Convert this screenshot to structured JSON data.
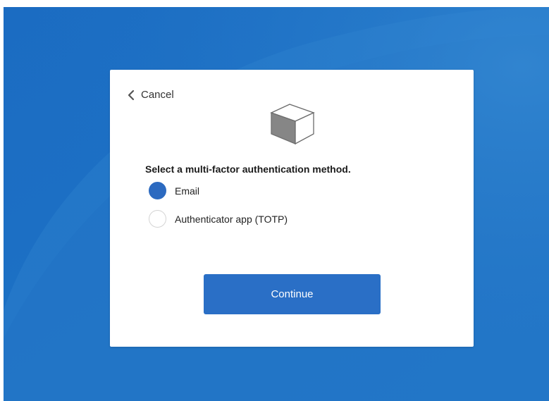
{
  "navigation": {
    "cancel_label": "Cancel"
  },
  "mfa": {
    "heading": "Select a multi-factor authentication method.",
    "options": [
      {
        "label": "Email",
        "selected": true
      },
      {
        "label": "Authenticator app (TOTP)",
        "selected": false
      }
    ]
  },
  "actions": {
    "continue_label": "Continue"
  },
  "colors": {
    "background": "#1f72c4",
    "accent": "#2a6fc6",
    "card": "#ffffff"
  },
  "icons": {
    "back": "chevron-left-icon",
    "logo": "cube-logo"
  }
}
